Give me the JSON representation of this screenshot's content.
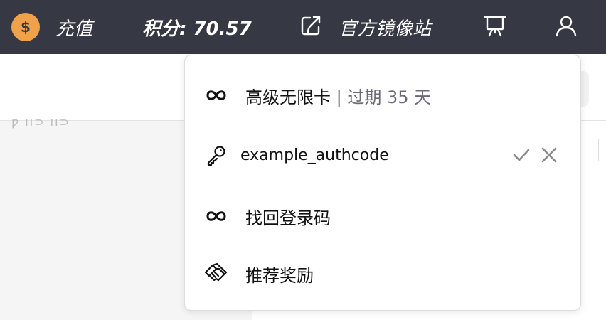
{
  "topbar": {
    "recharge_label": "充值",
    "points_label": "积分: 70.57",
    "mirror_label": "官方镜像站"
  },
  "background": {
    "faded_text": "ƿ ıı⊃ ıı⊃"
  },
  "menu": {
    "items": [
      {
        "icon": "infinity-icon",
        "label": "高级无限卡",
        "suffix": " | 过期 35 天"
      },
      {
        "icon": "key-icon",
        "input_value": "example_authcode"
      },
      {
        "icon": "infinity-icon",
        "label": "找回登录码"
      },
      {
        "icon": "handshake-icon",
        "label": "推荐奖励"
      }
    ]
  },
  "colors": {
    "topbar_bg": "#363844",
    "coin": "#f0a24a",
    "muted_text": "#6b6b75",
    "action_icon": "#8a8a8a"
  }
}
